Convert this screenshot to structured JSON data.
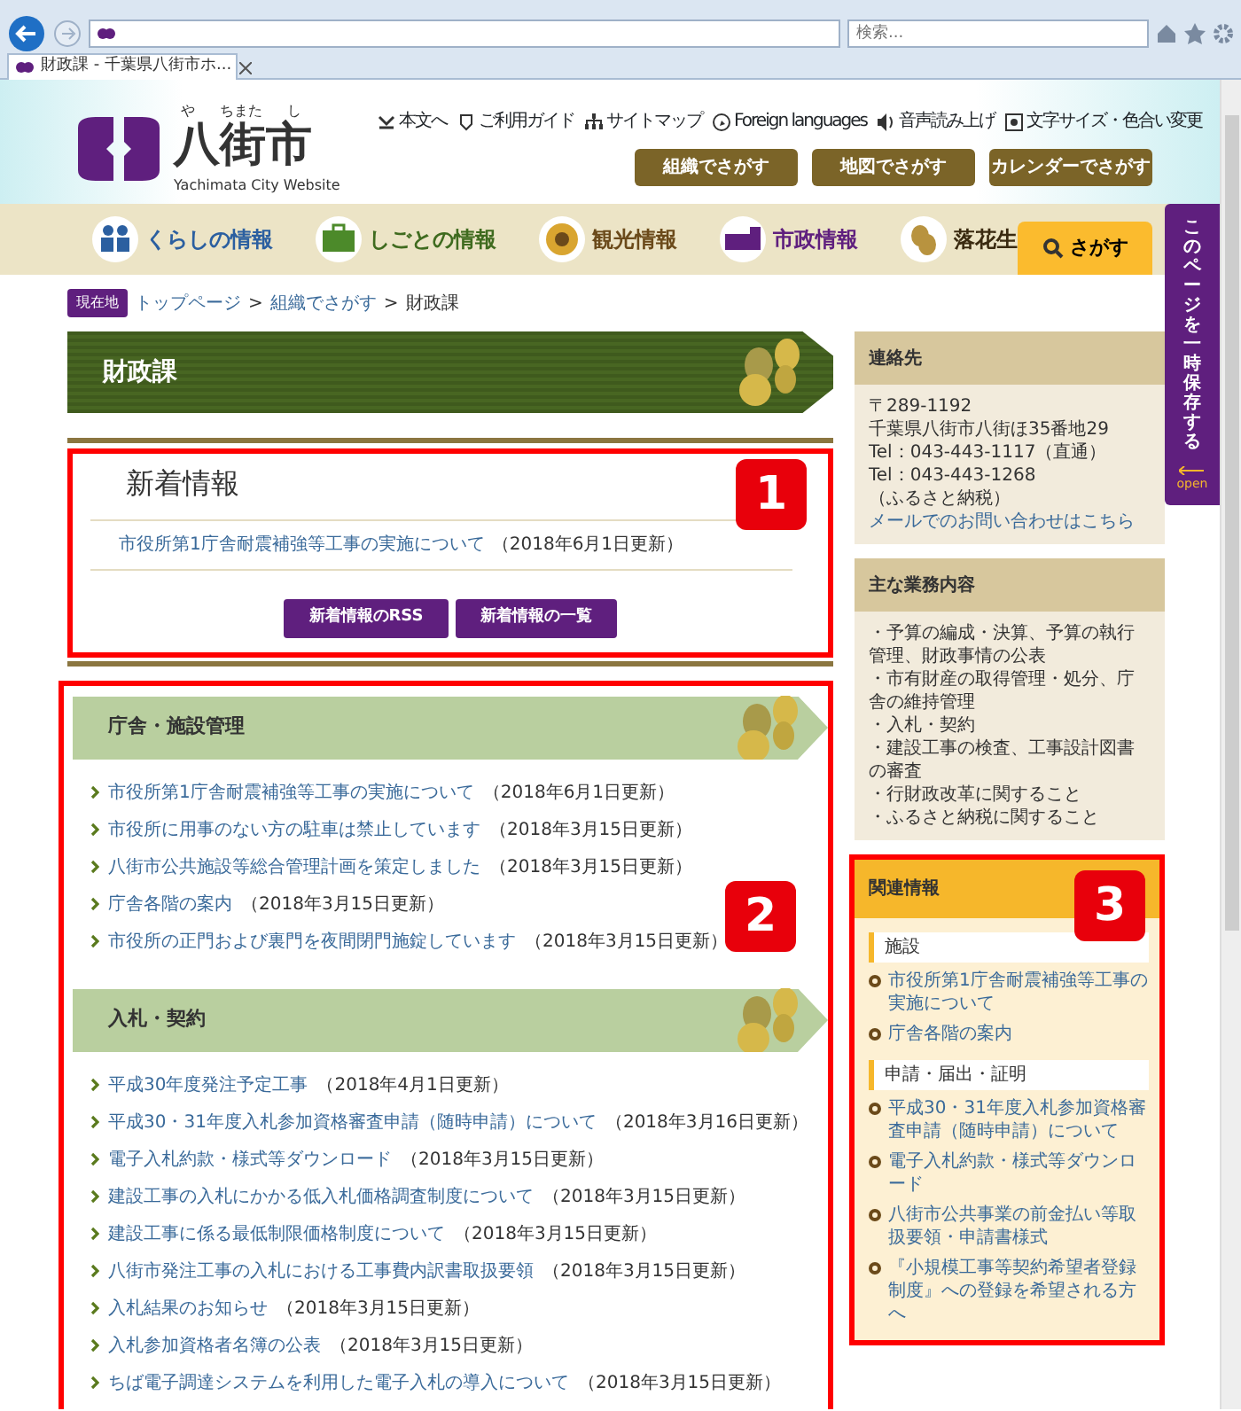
{
  "browser": {
    "search_placeholder": "検索...",
    "tab_title": "財政課 - 千葉県八街市ホ..."
  },
  "header": {
    "logo_ruby": [
      "や",
      "ちまた",
      "し"
    ],
    "logo_text": "八街市",
    "logo_sub": "Yachimata City Website",
    "utility_links": [
      "本文へ",
      "ご利用ガイド",
      "サイトマップ",
      "Foreign languages",
      "音声読み上げ",
      "文字サイズ・色合い変更"
    ],
    "buttons": [
      "組織でさがす",
      "地図でさがす",
      "カレンダーでさがす"
    ]
  },
  "nav": {
    "items": [
      {
        "label": "くらしの情報",
        "color": "#2b5fa0"
      },
      {
        "label": "しごとの情報",
        "color": "#3f6b1f"
      },
      {
        "label": "観光情報",
        "color": "#6b4a1a"
      },
      {
        "label": "市政情報",
        "color": "#5f1f7e"
      },
      {
        "label": "落花生",
        "color": "#3a2a10"
      }
    ],
    "search": "さがす"
  },
  "save_tab": {
    "label": "このページを一時保存する",
    "open": "open"
  },
  "breadcrumb": {
    "label": "現在地",
    "separator": ">",
    "items": [
      {
        "text": "トップページ",
        "link": true
      },
      {
        "text": "組織でさがす",
        "link": true
      },
      {
        "text": "財政課",
        "link": false
      }
    ]
  },
  "page_title": "財政課",
  "news": {
    "callout": "1",
    "title": "新着情報",
    "items": [
      {
        "text": "市役所第1庁舎耐震補強等工事の実施について",
        "date": "（2018年6月1日更新）"
      }
    ],
    "buttons": [
      "新着情報のRSS",
      "新着情報の一覧"
    ]
  },
  "sections": {
    "callout": "2",
    "groups": [
      {
        "title": "庁舎・施設管理",
        "items": [
          {
            "text": "市役所第1庁舎耐震補強等工事の実施について",
            "date": "（2018年6月1日更新）"
          },
          {
            "text": "市役所に用事のない方の駐車は禁止しています",
            "date": "（2018年3月15日更新）"
          },
          {
            "text": "八街市公共施設等総合管理計画を策定しました",
            "date": "（2018年3月15日更新）"
          },
          {
            "text": "庁舎各階の案内",
            "date": "（2018年3月15日更新）"
          },
          {
            "text": "市役所の正門および裏門を夜間閉門施錠しています",
            "date": "（2018年3月15日更新）"
          }
        ]
      },
      {
        "title": "入札・契約",
        "items": [
          {
            "text": "平成30年度発注予定工事",
            "date": "（2018年4月1日更新）"
          },
          {
            "text": "平成30・31年度入札参加資格審査申請（随時申請）について",
            "date": "（2018年3月16日更新）"
          },
          {
            "text": "電子入札約款・様式等ダウンロード",
            "date": "（2018年3月15日更新）"
          },
          {
            "text": "建設工事の入札にかかる低入札価格調査制度について",
            "date": "（2018年3月15日更新）"
          },
          {
            "text": "建設工事に係る最低制限価格制度について",
            "date": "（2018年3月15日更新）"
          },
          {
            "text": "八街市発注工事の入札における工事費内訳書取扱要領",
            "date": "（2018年3月15日更新）"
          },
          {
            "text": "入札結果のお知らせ",
            "date": "（2018年3月15日更新）"
          },
          {
            "text": "入札参加資格者名簿の公表",
            "date": "（2018年3月15日更新）"
          },
          {
            "text": "ちば電子調達システムを利用した電子入札の導入について",
            "date": "（2018年3月15日更新）"
          }
        ]
      }
    ]
  },
  "contact": {
    "title": "連絡先",
    "lines": [
      "〒289-1192",
      "千葉県八街市八街ほ35番地29",
      "Tel：043-443-1117（直通）",
      "Tel：043-443-1268",
      "（ふるさと納税）"
    ],
    "link": "メールでのお問い合わせはこちら"
  },
  "duties": {
    "title": "主な業務内容",
    "items": [
      "・予算の編成・決算、予算の執行管理、財政事情の公表",
      "・市有財産の取得管理・処分、庁舎の維持管理",
      "・入札・契約",
      "・建設工事の検査、工事設計図書の審査",
      "・行財政改革に関すること",
      "・ふるさと納税に関すること"
    ]
  },
  "related": {
    "callout": "3",
    "title": "関連情報",
    "groups": [
      {
        "heading": "施設",
        "links": [
          "市役所第1庁舎耐震補強等工事の実施について",
          "庁舎各階の案内"
        ]
      },
      {
        "heading": "申請・届出・証明",
        "links": [
          "平成30・31年度入札参加資格審査申請（随時申請）について",
          "電子入札約款・様式等ダウンロード",
          "八街市公共事業の前金払い等取扱要領・申請書様式",
          "『小規模工事等契約希望者登録制度』への登録を希望される方へ"
        ]
      }
    ]
  }
}
